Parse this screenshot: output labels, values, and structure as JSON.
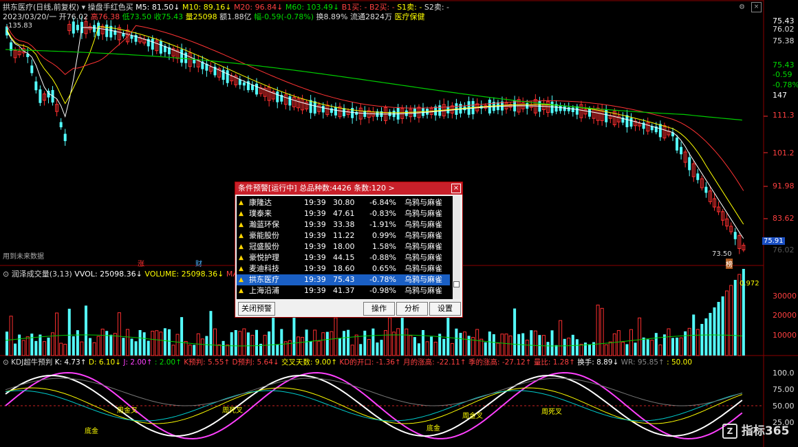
{
  "header": {
    "stock": "拱东医疗(日线,前复权)",
    "indicator_name": "操盘手红色买",
    "m5": "M5: 81.50↓",
    "m10": "M10: 89.16↓",
    "m20": "M20: 96.84↓",
    "m60": "M60: 103.49↓",
    "b1": "B1买: -",
    "b2": "B2买: -",
    "s1": "S1卖: -",
    "s2": "S2卖: -",
    "date_open": "2023/03/20/一 开76.02",
    "high": "高76.38",
    "low": "低73.50",
    "close": "收75.43",
    "volume": "量25098",
    "amount": "额1.88亿",
    "change": "幅-0.59(-0.78%)",
    "turnover": "换8.89%",
    "float": "流通2824万",
    "sector": "医疗保健"
  },
  "price_axis": {
    "right_top": [
      "75.43",
      "76.02",
      "75.38",
      "75.43",
      "-0.59",
      "-0.78%",
      "147"
    ],
    "ticks": [
      "111.3",
      "101.2",
      "91.98",
      "83.62",
      "75.91"
    ],
    "hidden": "76.02",
    "high_label": "135.83",
    "low_label": "73.50",
    "future_note": "用到未来数据",
    "tag_zhang": "涨",
    "tag_cai": "财",
    "tag_bang": "榜"
  },
  "volume_panel": {
    "title": "润泽成交量(3,13)",
    "vvol": "VVOL: 25098.36↓",
    "volume": "VOLUME: 25098.36↓",
    "mavol": "MAVOL",
    "ratio": "0.972",
    "ticks": [
      "30000",
      "20000",
      "10000"
    ]
  },
  "kdj_panel": {
    "title": "KDJ超牛预判",
    "k": "K: 4.73↑",
    "d": "D: 6.10↓",
    "j": "J: 2.00↑",
    "j2": ": 2.00↑",
    "kpred": "K预判: 5.55↑",
    "dpred": "D预判: 5.64↓",
    "cross_days": "交叉天数: 9.00↑",
    "kd_open": "KD的开口: -1.36↑",
    "month_high": "月的涨高: -22.11↑",
    "season_high": "季的涨高: -27.12↑",
    "vol_ratio": "量比: 1.28↑",
    "turnover": "换手: 8.89↓",
    "wr": "WR: 95.85↑",
    "fifty": ": 50.00",
    "ticks": [
      "100.0",
      "75.00",
      "50.00",
      "25.00"
    ],
    "labels": [
      "周金叉",
      "周死叉",
      "周金叉",
      "周死叉",
      "底金",
      "底金"
    ]
  },
  "dialog": {
    "title": "条件预警[运行中] 总品种数:4426 条数:120 >",
    "close": "×",
    "rows": [
      {
        "name": "康隆达",
        "time": "19:39",
        "price": "30.80",
        "pct": "-6.84%",
        "cond": "乌鸦与麻雀"
      },
      {
        "name": "璞泰来",
        "time": "19:39",
        "price": "47.61",
        "pct": "-0.83%",
        "cond": "乌鸦与麻雀"
      },
      {
        "name": "瀚蓝环保",
        "time": "19:39",
        "price": "33.38",
        "pct": "-1.91%",
        "cond": "乌鸦与麻雀"
      },
      {
        "name": "豪能股份",
        "time": "19:39",
        "price": "11.22",
        "pct": "0.99%",
        "cond": "乌鸦与麻雀"
      },
      {
        "name": "冠盛股份",
        "time": "19:39",
        "price": "18.00",
        "pct": "1.58%",
        "cond": "乌鸦与麻雀"
      },
      {
        "name": "豪悦护理",
        "time": "19:39",
        "price": "44.15",
        "pct": "-0.88%",
        "cond": "乌鸦与麻雀"
      },
      {
        "name": "麦迪科技",
        "time": "19:39",
        "price": "18.60",
        "pct": "0.65%",
        "cond": "乌鸦与麻雀"
      },
      {
        "name": "拱东医疗",
        "time": "19:39",
        "price": "75.43",
        "pct": "-0.78%",
        "cond": "乌鸦与麻雀"
      },
      {
        "name": "上海沿浦",
        "time": "19:39",
        "price": "41.37",
        "pct": "-0.98%",
        "cond": "乌鸦与麻雀"
      }
    ],
    "selected_index": 7,
    "buttons": {
      "close_alert": "关闭预警",
      "operate": "操作",
      "analyze": "分析",
      "settings": "设置"
    }
  },
  "watermark": "指标365",
  "colors": {
    "up": "#ff3030",
    "down": "#54ffff",
    "ma5": "#ffffff",
    "ma10": "#ffff00",
    "ma20": "#ff3333",
    "ma60": "#00cc00",
    "select": "#1a5fc4",
    "title": "#c8202a"
  }
}
